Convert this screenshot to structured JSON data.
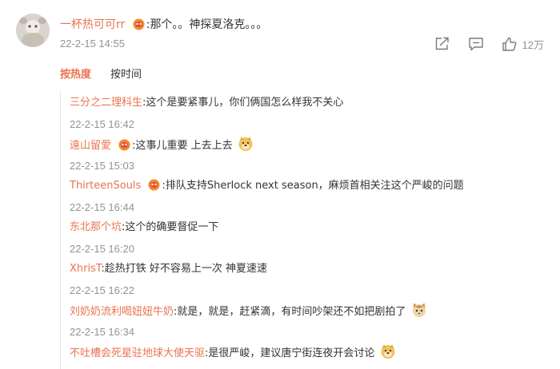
{
  "top_comment": {
    "username": "一杯热可可rr",
    "separator": ":",
    "text": "那个。。神探夏洛克。。。",
    "time": "22-2-15 14:55",
    "like_count": "12万"
  },
  "sort_tabs": [
    {
      "label": "按热度",
      "active": true
    },
    {
      "label": "按时间",
      "active": false
    }
  ],
  "replies": [
    {
      "username": "三分之二理科生",
      "separator": ":",
      "text": "这个是要紧事儿，你们俩国怎么样我不关心",
      "time": "22-2-15 16:42"
    },
    {
      "username": "遠山留愛",
      "separator": ":",
      "text": "这事儿重要 上去上去",
      "time": "22-2-15 15:03"
    },
    {
      "username": "ThirteenSouls",
      "separator": ":",
      "text": "排队支持Sherlock next season，麻烦首相关注这个严峻的问题",
      "time": "22-2-15 16:44"
    },
    {
      "username": "东北那个坑",
      "separator": ":",
      "text": "这个的确要督促一下",
      "time": "22-2-15 16:20"
    },
    {
      "username": "XhrisT",
      "separator": ":",
      "text": "趁热打铁 好不容易上一次 神夏速速",
      "time": "22-2-15 16:22"
    },
    {
      "username": "刘奶奶流利喝妞妞牛奶",
      "separator": ":",
      "text": "就是，就是，赶紧滴，有时间吵架还不如把剧拍了",
      "time": "22-2-15 16:34"
    },
    {
      "username": "不吐槽会死星驻地球大使天驱",
      "separator": ":",
      "text": "是很严峻，建议唐宁街连夜开会讨论",
      "time": ""
    }
  ],
  "colors": {
    "username": "#eb7350",
    "text": "#333333",
    "time": "#939393",
    "badge": "#f08c2b"
  },
  "icons": {
    "share": "share-icon",
    "comment": "comment-icon",
    "like": "like-icon",
    "badge": "vip-badge-icon",
    "doge": "doge-emoji-icon",
    "cat": "cat-emoji-icon"
  }
}
